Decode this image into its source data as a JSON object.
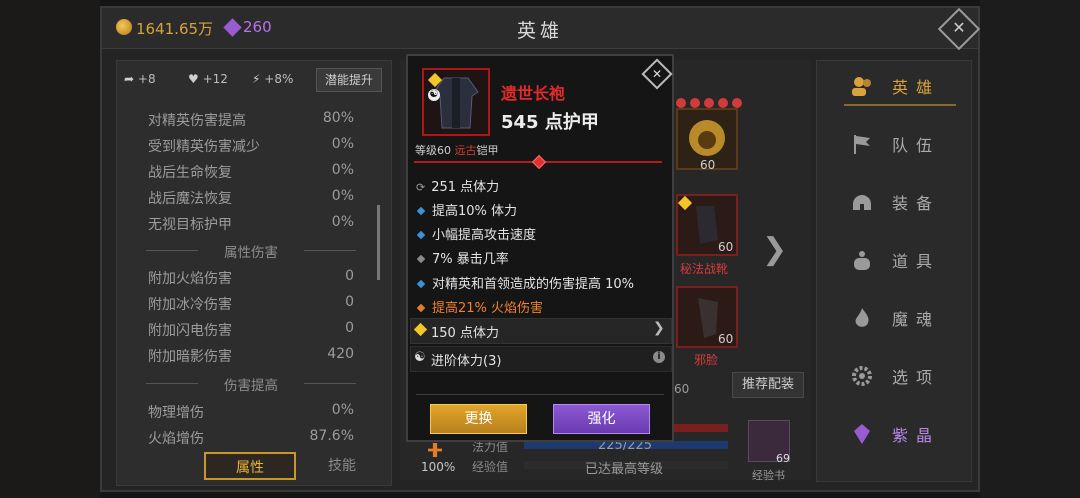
{
  "header": {
    "gold": "1641.65万",
    "gems": "260",
    "title": "英雄"
  },
  "potential": {
    "arrow_bonus": "+8",
    "heart_bonus": "+12",
    "bolt_bonus": "+8%",
    "button": "潜能提升"
  },
  "stats": {
    "rows_top": [
      {
        "label": "对精英伤害提高",
        "value": "80%"
      },
      {
        "label": "受到精英伤害减少",
        "value": "0%"
      },
      {
        "label": "战后生命恢复",
        "value": "0%"
      },
      {
        "label": "战后魔法恢复",
        "value": "0%"
      },
      {
        "label": "无视目标护甲",
        "value": "0%"
      }
    ],
    "section_attr": "属性伤害",
    "rows_attr": [
      {
        "label": "附加火焰伤害",
        "value": "0"
      },
      {
        "label": "附加冰冷伤害",
        "value": "0"
      },
      {
        "label": "附加闪电伤害",
        "value": "0"
      },
      {
        "label": "附加暗影伤害",
        "value": "420"
      }
    ],
    "section_dmg": "伤害提高",
    "rows_dmg": [
      {
        "label": "物理增伤",
        "value": "0%"
      },
      {
        "label": "火焰增伤",
        "value": "87.6%"
      }
    ]
  },
  "tabs": {
    "attr": "属性",
    "skill": "技能"
  },
  "hero": {
    "slot_levels": [
      "60",
      "60",
      "60"
    ],
    "slot2_name": "秘法战靴",
    "slot3_name": "邪脸",
    "stray_60": "60",
    "recommend": "推荐配装",
    "mana_label": "法力值",
    "mana_value": "225/225",
    "xp_label": "经验值",
    "xp_value": "已达最高等级",
    "percent": "100%",
    "book_count": "69",
    "book_label": "经验书"
  },
  "nav": [
    {
      "label": "英雄",
      "icon": "hero-icon"
    },
    {
      "label": "队伍",
      "icon": "flag-icon"
    },
    {
      "label": "装备",
      "icon": "helmet-icon"
    },
    {
      "label": "道具",
      "icon": "bag-icon"
    },
    {
      "label": "魔魂",
      "icon": "flame-icon"
    },
    {
      "label": "选项",
      "icon": "gear-icon"
    },
    {
      "label": "紫晶",
      "icon": "crystal-icon"
    }
  ],
  "item": {
    "name": "遗世长袍",
    "armor": "545 点护甲",
    "level_prefix": "等级60",
    "rarity": "远古",
    "type": "铠甲",
    "affixes": [
      {
        "text": "251 点体力",
        "kind": "base"
      },
      {
        "text": "提高10% 体力",
        "kind": "blue"
      },
      {
        "text": "小幅提高攻击速度",
        "kind": "blue"
      },
      {
        "text": "7% 暴击几率",
        "kind": "grey"
      },
      {
        "text": "对精英和首领造成的伤害提高 10%",
        "kind": "blue"
      },
      {
        "text": "提高21% 火焰伤害",
        "kind": "orange"
      }
    ],
    "socket": "150 点体力",
    "advance": "进阶体力(3)",
    "btn_replace": "更换",
    "btn_enhance": "强化"
  },
  "colors": {
    "accent_gold": "#d9a23a",
    "rarity_red": "#e12a2a",
    "gem_purple": "#b574e8"
  }
}
